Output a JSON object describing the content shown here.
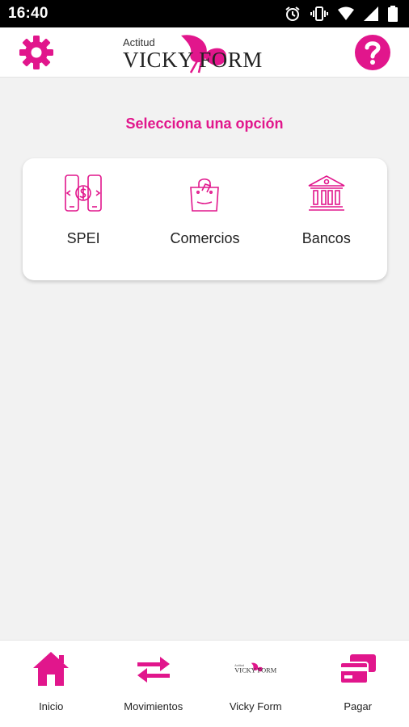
{
  "status_bar": {
    "time": "16:40",
    "icons": [
      "alarm-icon",
      "vibrate-icon",
      "wifi-icon",
      "signal-icon",
      "battery-icon"
    ]
  },
  "header": {
    "left_icon": "gear-icon",
    "right_icon": "help-icon",
    "logo": {
      "small_text": "Actitud",
      "main_text": "VICKY FORM"
    }
  },
  "title": "Selecciona una opción",
  "options": [
    {
      "label": "SPEI",
      "icon": "phone-transfer-icon"
    },
    {
      "label": "Comercios",
      "icon": "shopping-bag-icon"
    },
    {
      "label": "Bancos",
      "icon": "bank-icon"
    }
  ],
  "bottom_nav": [
    {
      "label": "Inicio",
      "icon": "home-icon"
    },
    {
      "label": "Movimientos",
      "icon": "transfer-arrows-icon"
    },
    {
      "label": "Vicky Form",
      "icon": "vicky-form-logo"
    },
    {
      "label": "Pagar",
      "icon": "cards-icon"
    }
  ],
  "colors": {
    "accent": "#e1168c",
    "background": "#f2f2f2",
    "card": "#ffffff",
    "text": "#222222"
  }
}
